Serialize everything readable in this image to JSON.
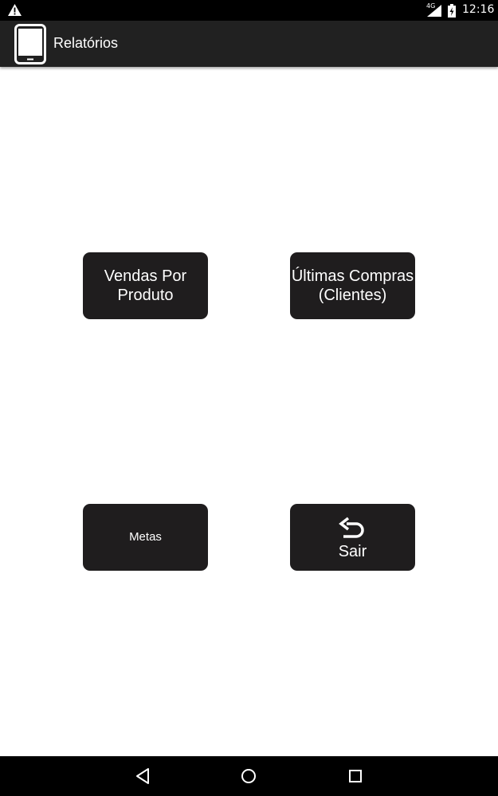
{
  "status_bar": {
    "network_type": "4G",
    "time": "12:16",
    "icons": [
      "warning-icon",
      "signal-icon",
      "battery-charging-icon"
    ]
  },
  "action_bar": {
    "title": "Relatórios",
    "icon": "tablet-icon"
  },
  "buttons": {
    "vendas_por_produto": "Vendas Por Produto",
    "ultimas_compras": "Últimas Compras (Clientes)",
    "metas": "Metas",
    "sair": "Sair",
    "sair_icon": "undo-icon"
  },
  "nav_bar": {
    "icons": [
      "back-icon",
      "home-icon",
      "recent-apps-icon"
    ]
  },
  "colors": {
    "status_bar": "#000000",
    "action_bar": "#212121",
    "button_bg": "#1f1d1e",
    "button_text": "#ffffff",
    "background": "#ffffff"
  }
}
